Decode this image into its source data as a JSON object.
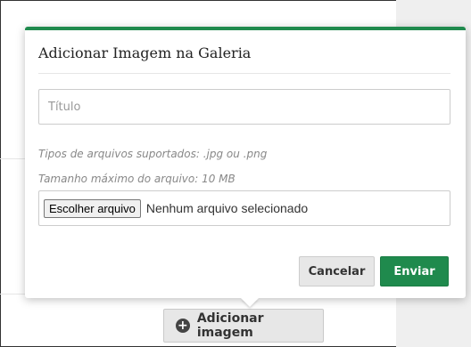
{
  "dialog": {
    "title": "Adicionar Imagem na Galeria",
    "title_placeholder": "Título",
    "hint_types": "Tipos de arquivos suportados: .jpg ou .png",
    "hint_size": "Tamanho máximo do arquivo: 10 MB",
    "choose_file_label": "Escolher arquivo",
    "no_file_text": "Nenhum arquivo selecionado",
    "cancel_label": "Cancelar",
    "send_label": "Enviar"
  },
  "background": {
    "add_image_label": "Adicionar imagem",
    "add_image_icon": "plus-circle-icon"
  },
  "colors": {
    "accent": "#1f8a4d",
    "button_gray": "#e7e7e7",
    "side_panel": "#efefef"
  }
}
